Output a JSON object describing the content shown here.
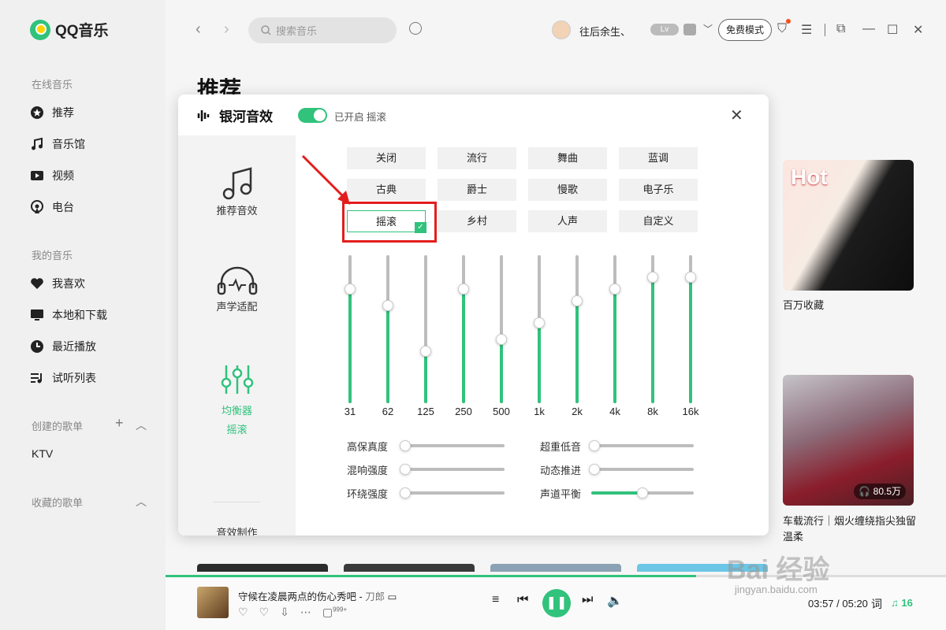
{
  "app": {
    "name": "QQ音乐"
  },
  "sidebar": {
    "online_section": "在线音乐",
    "online_items": [
      {
        "label": "推荐",
        "icon": "star-icon"
      },
      {
        "label": "音乐馆",
        "icon": "music-note-icon"
      },
      {
        "label": "视频",
        "icon": "video-icon"
      },
      {
        "label": "电台",
        "icon": "radio-icon"
      }
    ],
    "my_section": "我的音乐",
    "my_items": [
      {
        "label": "我喜欢",
        "icon": "heart-icon"
      },
      {
        "label": "本地和下载",
        "icon": "monitor-icon"
      },
      {
        "label": "最近播放",
        "icon": "clock-icon"
      },
      {
        "label": "试听列表",
        "icon": "playlist-icon"
      }
    ],
    "created_section": "创建的歌单",
    "created_items": [
      "KTV"
    ],
    "collected_section": "收藏的歌单"
  },
  "topbar": {
    "search_placeholder": "搜索音乐",
    "username": "往后余生、",
    "vip_badge": "Lv",
    "free_mode": "免费模式"
  },
  "page": {
    "title": "推荐"
  },
  "cards": [
    {
      "badge": "Hot",
      "caption": "百万收藏"
    },
    {
      "plays": "80.5万",
      "caption": "车载流行｜烟火缠绕指尖独留温柔"
    }
  ],
  "equalizer": {
    "title": "银河音效",
    "enabled": true,
    "status": "已开启 摇滚",
    "tabs": [
      {
        "label": "推荐音效",
        "icon": "music-notes-icon",
        "sub": ""
      },
      {
        "label": "声学适配",
        "icon": "headphones-icon",
        "sub": ""
      },
      {
        "label": "均衡器",
        "icon": "equalizer-icon",
        "sub": "摇滚"
      },
      {
        "label": "音效制作",
        "icon": "",
        "sub": ""
      }
    ],
    "presets": [
      "关闭",
      "流行",
      "舞曲",
      "蓝调",
      "古典",
      "爵士",
      "慢歌",
      "电子乐",
      "摇滚",
      "乡村",
      "人声",
      "自定义"
    ],
    "selected_preset": "摇滚",
    "bands": [
      {
        "label": "31",
        "level": 0.77
      },
      {
        "label": "62",
        "level": 0.66
      },
      {
        "label": "125",
        "level": 0.35
      },
      {
        "label": "250",
        "level": 0.77
      },
      {
        "label": "500",
        "level": 0.43
      },
      {
        "label": "1k",
        "level": 0.54
      },
      {
        "label": "2k",
        "level": 0.69
      },
      {
        "label": "4k",
        "level": 0.77
      },
      {
        "label": "8k",
        "level": 0.85
      },
      {
        "label": "16k",
        "level": 0.85
      }
    ],
    "controls": [
      {
        "label": "高保真度",
        "value": 0.0
      },
      {
        "label": "超重低音",
        "value": 0.0
      },
      {
        "label": "混响强度",
        "value": 0.0
      },
      {
        "label": "动态推进",
        "value": 0.0
      },
      {
        "label": "环绕强度",
        "value": 0.0
      },
      {
        "label": "声道平衡",
        "value": 0.5
      }
    ]
  },
  "player": {
    "song": "守候在凌晨两点的伤心秀吧",
    "artist": "刀郎",
    "comment_count": "999+",
    "time": "03:57 / 05:20",
    "lyric_btn": "词",
    "playlist_count": "16",
    "progress": 0.68
  },
  "watermark": {
    "main": "Bai 经验",
    "sub": "jingyan.baidu.com"
  },
  "colors": {
    "accent": "#31c27c",
    "highlight": "#e31d1d"
  }
}
